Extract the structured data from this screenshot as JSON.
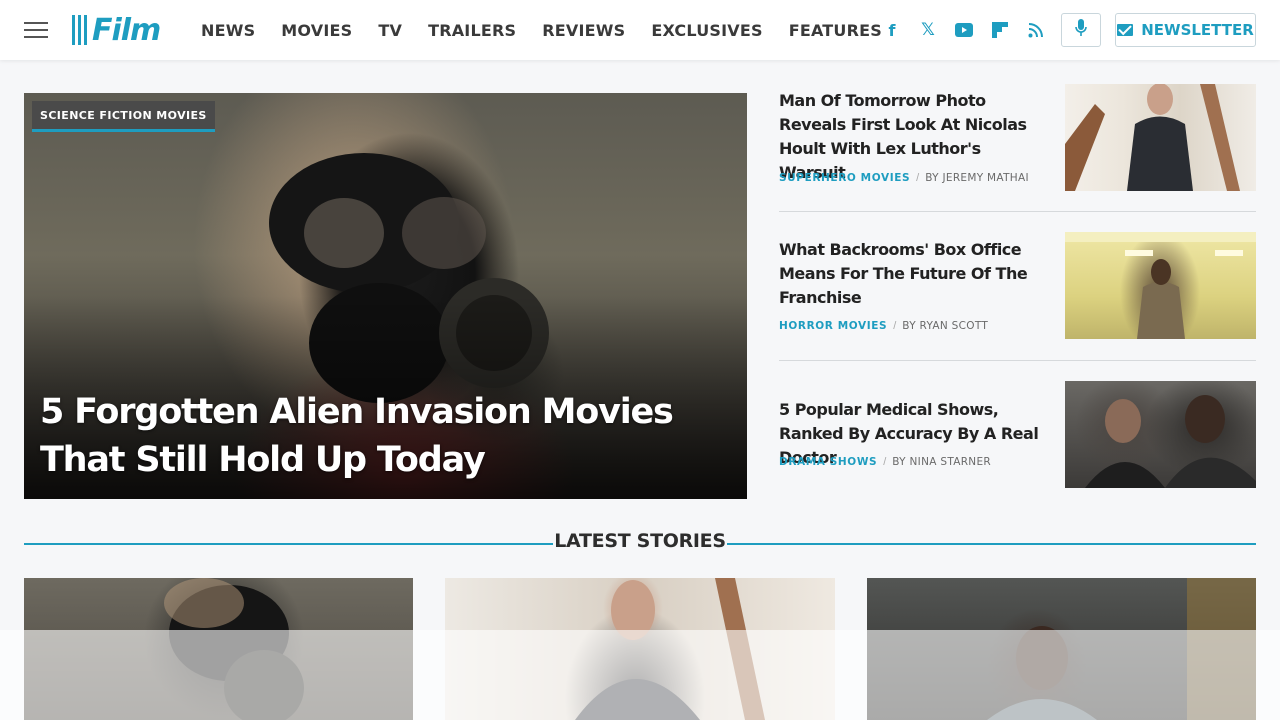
{
  "site": {
    "logo_text": "Film"
  },
  "nav": {
    "items": [
      {
        "label": "NEWS"
      },
      {
        "label": "MOVIES"
      },
      {
        "label": "TV"
      },
      {
        "label": "TRAILERS"
      },
      {
        "label": "REVIEWS"
      },
      {
        "label": "EXCLUSIVES"
      },
      {
        "label": "FEATURES"
      }
    ]
  },
  "social": {
    "facebook": "f",
    "x": "𝕏",
    "newsletter_label": "NEWSLETTER"
  },
  "icons": {
    "menu": "hamburger-icon",
    "facebook": "facebook-icon",
    "x": "x-icon",
    "youtube": "youtube-icon",
    "flipboard": "flipboard-icon",
    "rss": "rss-icon",
    "podcast": "microphone-icon",
    "newsletter": "envelope-icon"
  },
  "colors": {
    "accent": "#1e9dc0",
    "nav_text": "#3a3a3a",
    "tag_bg": "#4a4a4a"
  },
  "hero": {
    "category": "SCIENCE FICTION MOVIES",
    "title": "5 Forgotten Alien Invasion Movies That Still Hold Up Today"
  },
  "side_stories": [
    {
      "title": "Man Of Tomorrow Photo Reveals First Look At Nicolas Hoult With Lex Luthor's Warsuit",
      "category": "SUPERHERO MOVIES",
      "author": "BY JEREMY MATHAI"
    },
    {
      "title": "What Backrooms' Box Office Means For The Future Of The Franchise",
      "category": "HORROR MOVIES",
      "author": "BY RYAN SCOTT"
    },
    {
      "title": "5 Popular Medical Shows, Ranked By Accuracy By A Real Doctor",
      "category": "DRAMA SHOWS",
      "author": "BY NINA STARNER"
    }
  ],
  "latest": {
    "heading": "LATEST STORIES"
  }
}
